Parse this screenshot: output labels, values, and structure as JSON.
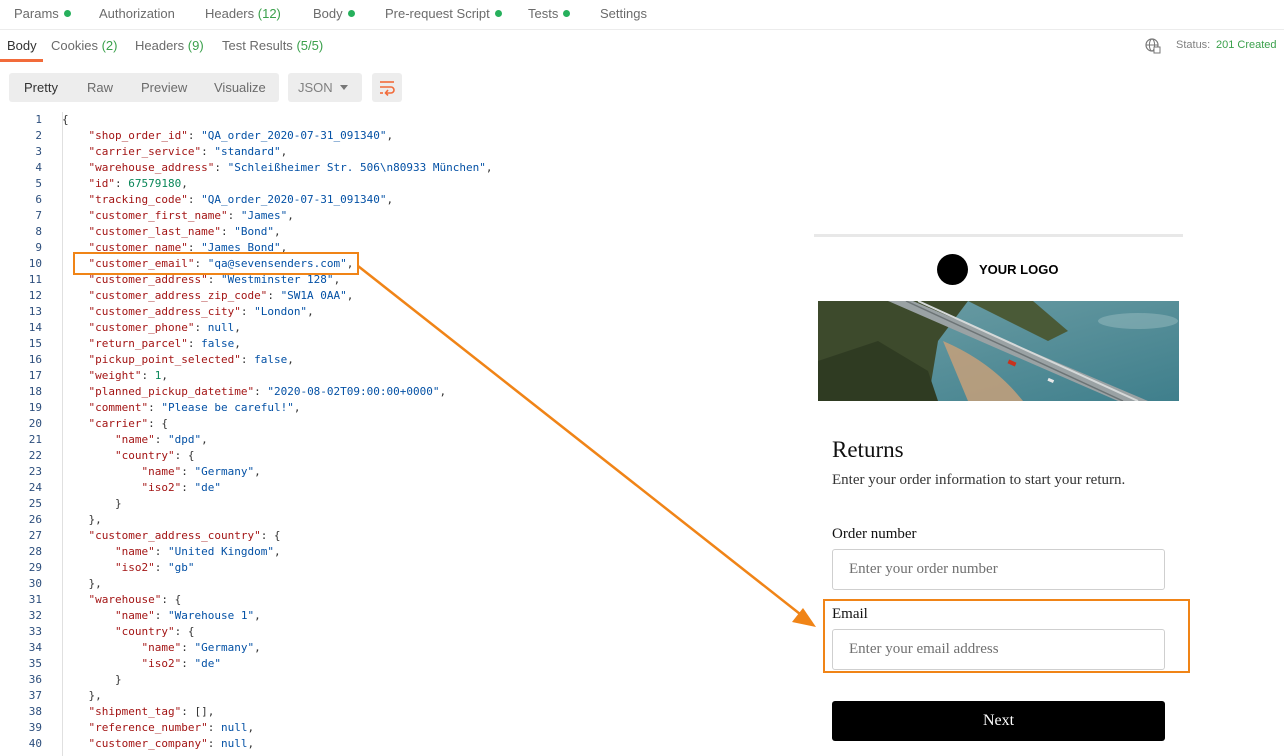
{
  "request_tabs": [
    {
      "label": "Params",
      "count": "",
      "dot": true
    },
    {
      "label": "Authorization",
      "count": "",
      "dot": false
    },
    {
      "label": "Headers",
      "count": "(12)",
      "dot": false
    },
    {
      "label": "Body",
      "count": "",
      "dot": true
    },
    {
      "label": "Pre-request Script",
      "count": "",
      "dot": true
    },
    {
      "label": "Tests",
      "count": "",
      "dot": true
    },
    {
      "label": "Settings",
      "count": "",
      "dot": false
    }
  ],
  "response_tabs": [
    {
      "label": "Body",
      "count": ""
    },
    {
      "label": "Cookies",
      "count": "(2)"
    },
    {
      "label": "Headers",
      "count": "(9)"
    },
    {
      "label": "Test Results",
      "count": "(5/5)"
    }
  ],
  "status": {
    "label": "Status:",
    "value": "201 Created"
  },
  "view_modes": [
    "Pretty",
    "Raw",
    "Preview",
    "Visualize"
  ],
  "format": "JSON",
  "code_lines": [
    [
      [
        "p",
        "{"
      ]
    ],
    [
      [
        "p",
        "    "
      ],
      [
        "k",
        "\"shop_order_id\""
      ],
      [
        "p",
        ": "
      ],
      [
        "s",
        "\"QA_order_2020-07-31_091340\""
      ],
      [
        "p",
        ","
      ]
    ],
    [
      [
        "p",
        "    "
      ],
      [
        "k",
        "\"carrier_service\""
      ],
      [
        "p",
        ": "
      ],
      [
        "s",
        "\"standard\""
      ],
      [
        "p",
        ","
      ]
    ],
    [
      [
        "p",
        "    "
      ],
      [
        "k",
        "\"warehouse_address\""
      ],
      [
        "p",
        ": "
      ],
      [
        "s",
        "\"Schleißheimer Str. 506\\n80933 München\""
      ],
      [
        "p",
        ","
      ]
    ],
    [
      [
        "p",
        "    "
      ],
      [
        "k",
        "\"id\""
      ],
      [
        "p",
        ": "
      ],
      [
        "n",
        "67579180"
      ],
      [
        "p",
        ","
      ]
    ],
    [
      [
        "p",
        "    "
      ],
      [
        "k",
        "\"tracking_code\""
      ],
      [
        "p",
        ": "
      ],
      [
        "s",
        "\"QA_order_2020-07-31_091340\""
      ],
      [
        "p",
        ","
      ]
    ],
    [
      [
        "p",
        "    "
      ],
      [
        "k",
        "\"customer_first_name\""
      ],
      [
        "p",
        ": "
      ],
      [
        "s",
        "\"James\""
      ],
      [
        "p",
        ","
      ]
    ],
    [
      [
        "p",
        "    "
      ],
      [
        "k",
        "\"customer_last_name\""
      ],
      [
        "p",
        ": "
      ],
      [
        "s",
        "\"Bond\""
      ],
      [
        "p",
        ","
      ]
    ],
    [
      [
        "p",
        "    "
      ],
      [
        "k",
        "\"customer_name\""
      ],
      [
        "p",
        ": "
      ],
      [
        "s",
        "\"James Bond\""
      ],
      [
        "p",
        ","
      ]
    ],
    [
      [
        "p",
        "    "
      ],
      [
        "k",
        "\"customer_email\""
      ],
      [
        "p",
        ": "
      ],
      [
        "s",
        "\"qa@sevensenders.com\""
      ],
      [
        "p",
        ","
      ]
    ],
    [
      [
        "p",
        "    "
      ],
      [
        "k",
        "\"customer_address\""
      ],
      [
        "p",
        ": "
      ],
      [
        "s",
        "\"Westminster 128\""
      ],
      [
        "p",
        ","
      ]
    ],
    [
      [
        "p",
        "    "
      ],
      [
        "k",
        "\"customer_address_zip_code\""
      ],
      [
        "p",
        ": "
      ],
      [
        "s",
        "\"SW1A 0AA\""
      ],
      [
        "p",
        ","
      ]
    ],
    [
      [
        "p",
        "    "
      ],
      [
        "k",
        "\"customer_address_city\""
      ],
      [
        "p",
        ": "
      ],
      [
        "s",
        "\"London\""
      ],
      [
        "p",
        ","
      ]
    ],
    [
      [
        "p",
        "    "
      ],
      [
        "k",
        "\"customer_phone\""
      ],
      [
        "p",
        ": "
      ],
      [
        "b",
        "null"
      ],
      [
        "p",
        ","
      ]
    ],
    [
      [
        "p",
        "    "
      ],
      [
        "k",
        "\"return_parcel\""
      ],
      [
        "p",
        ": "
      ],
      [
        "b",
        "false"
      ],
      [
        "p",
        ","
      ]
    ],
    [
      [
        "p",
        "    "
      ],
      [
        "k",
        "\"pickup_point_selected\""
      ],
      [
        "p",
        ": "
      ],
      [
        "b",
        "false"
      ],
      [
        "p",
        ","
      ]
    ],
    [
      [
        "p",
        "    "
      ],
      [
        "k",
        "\"weight\""
      ],
      [
        "p",
        ": "
      ],
      [
        "n",
        "1"
      ],
      [
        "p",
        ","
      ]
    ],
    [
      [
        "p",
        "    "
      ],
      [
        "k",
        "\"planned_pickup_datetime\""
      ],
      [
        "p",
        ": "
      ],
      [
        "s",
        "\"2020-08-02T09:00:00+0000\""
      ],
      [
        "p",
        ","
      ]
    ],
    [
      [
        "p",
        "    "
      ],
      [
        "k",
        "\"comment\""
      ],
      [
        "p",
        ": "
      ],
      [
        "s",
        "\"Please be careful!\""
      ],
      [
        "p",
        ","
      ]
    ],
    [
      [
        "p",
        "    "
      ],
      [
        "k",
        "\"carrier\""
      ],
      [
        "p",
        ": {"
      ]
    ],
    [
      [
        "p",
        "        "
      ],
      [
        "k",
        "\"name\""
      ],
      [
        "p",
        ": "
      ],
      [
        "s",
        "\"dpd\""
      ],
      [
        "p",
        ","
      ]
    ],
    [
      [
        "p",
        "        "
      ],
      [
        "k",
        "\"country\""
      ],
      [
        "p",
        ": {"
      ]
    ],
    [
      [
        "p",
        "            "
      ],
      [
        "k",
        "\"name\""
      ],
      [
        "p",
        ": "
      ],
      [
        "s",
        "\"Germany\""
      ],
      [
        "p",
        ","
      ]
    ],
    [
      [
        "p",
        "            "
      ],
      [
        "k",
        "\"iso2\""
      ],
      [
        "p",
        ": "
      ],
      [
        "s",
        "\"de\""
      ]
    ],
    [
      [
        "p",
        "        }"
      ]
    ],
    [
      [
        "p",
        "    },"
      ]
    ],
    [
      [
        "p",
        "    "
      ],
      [
        "k",
        "\"customer_address_country\""
      ],
      [
        "p",
        ": {"
      ]
    ],
    [
      [
        "p",
        "        "
      ],
      [
        "k",
        "\"name\""
      ],
      [
        "p",
        ": "
      ],
      [
        "s",
        "\"United Kingdom\""
      ],
      [
        "p",
        ","
      ]
    ],
    [
      [
        "p",
        "        "
      ],
      [
        "k",
        "\"iso2\""
      ],
      [
        "p",
        ": "
      ],
      [
        "s",
        "\"gb\""
      ]
    ],
    [
      [
        "p",
        "    },"
      ]
    ],
    [
      [
        "p",
        "    "
      ],
      [
        "k",
        "\"warehouse\""
      ],
      [
        "p",
        ": {"
      ]
    ],
    [
      [
        "p",
        "        "
      ],
      [
        "k",
        "\"name\""
      ],
      [
        "p",
        ": "
      ],
      [
        "s",
        "\"Warehouse 1\""
      ],
      [
        "p",
        ","
      ]
    ],
    [
      [
        "p",
        "        "
      ],
      [
        "k",
        "\"country\""
      ],
      [
        "p",
        ": {"
      ]
    ],
    [
      [
        "p",
        "            "
      ],
      [
        "k",
        "\"name\""
      ],
      [
        "p",
        ": "
      ],
      [
        "s",
        "\"Germany\""
      ],
      [
        "p",
        ","
      ]
    ],
    [
      [
        "p",
        "            "
      ],
      [
        "k",
        "\"iso2\""
      ],
      [
        "p",
        ": "
      ],
      [
        "s",
        "\"de\""
      ]
    ],
    [
      [
        "p",
        "        }"
      ]
    ],
    [
      [
        "p",
        "    },"
      ]
    ],
    [
      [
        "p",
        "    "
      ],
      [
        "k",
        "\"shipment_tag\""
      ],
      [
        "p",
        ": [],"
      ]
    ],
    [
      [
        "p",
        "    "
      ],
      [
        "k",
        "\"reference_number\""
      ],
      [
        "p",
        ": "
      ],
      [
        "b",
        "null"
      ],
      [
        "p",
        ","
      ]
    ],
    [
      [
        "p",
        "    "
      ],
      [
        "k",
        "\"customer_company\""
      ],
      [
        "p",
        ": "
      ],
      [
        "b",
        "null"
      ],
      [
        "p",
        ","
      ]
    ]
  ],
  "returns": {
    "logo_text": "YOUR LOGO",
    "title": "Returns",
    "subtitle": "Enter your order information to start your return.",
    "order_label": "Order number",
    "order_placeholder": "Enter your order number",
    "email_label": "Email",
    "email_placeholder": "Enter your email address",
    "next_label": "Next"
  },
  "colors": {
    "accent_orange": "#f08417",
    "status_green": "#3aa04b",
    "tab_underline": "#f26b3a"
  },
  "icons": [
    "globe-icon",
    "wrap-lines-icon",
    "chevron-down-icon",
    "status-dot-icon"
  ]
}
